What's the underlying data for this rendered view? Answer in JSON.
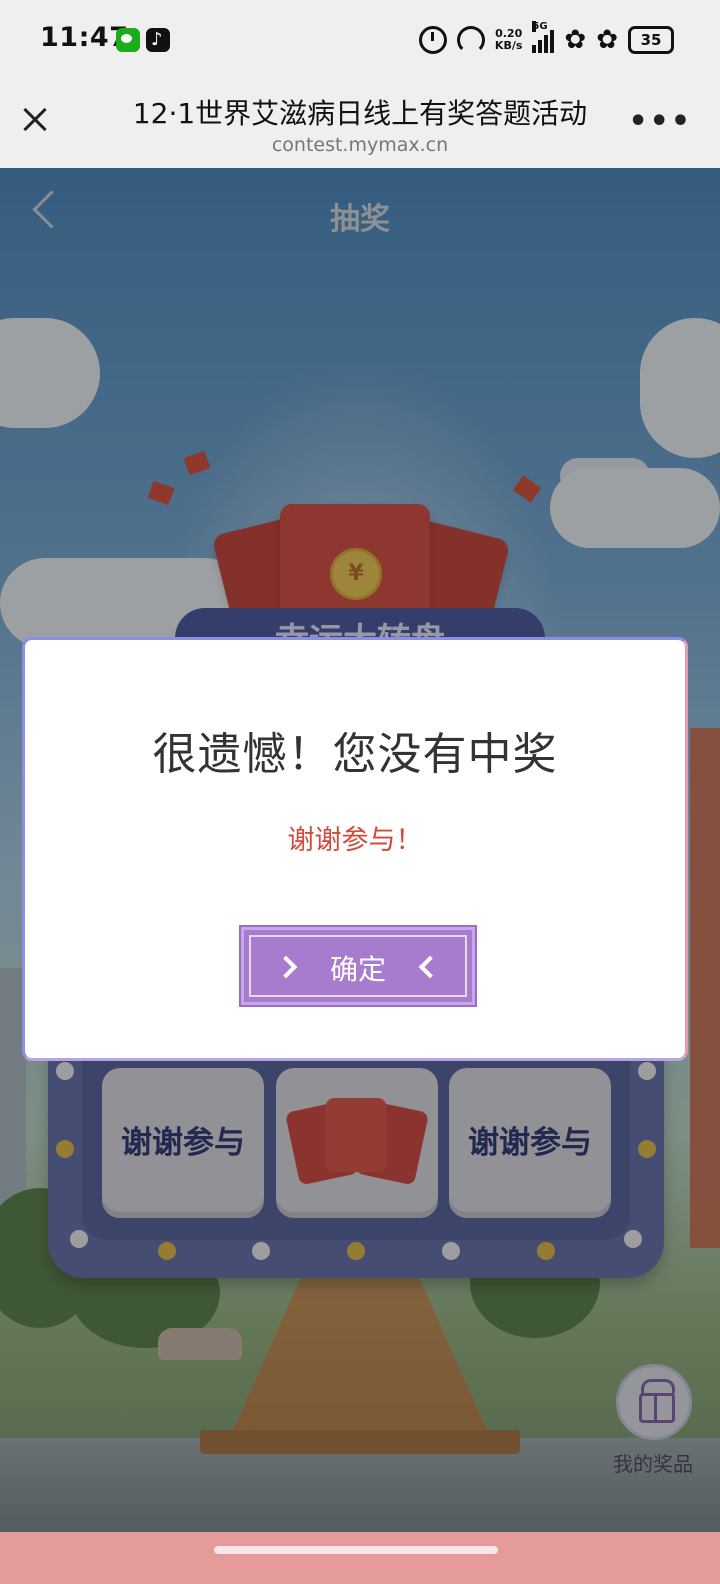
{
  "status_bar": {
    "time": "11:47",
    "net_speed_value": "0.20",
    "net_speed_unit": "KB/s",
    "network_type": "5G",
    "battery": "35"
  },
  "browser": {
    "title": "12·1世界艾滋病日线上有奖答题活动",
    "url": "contest.mymax.cn",
    "more_label": "•••"
  },
  "page": {
    "nav_title": "抽奖",
    "banner_peek": "幸运大转盘",
    "coin_symbol": "¥"
  },
  "grid": {
    "cells": [
      "谢谢参与",
      "",
      "谢谢参与"
    ]
  },
  "prizes": {
    "label": "我的奖品"
  },
  "modal": {
    "title": "很遗憾！您没有中奖",
    "subtitle": "谢谢参与！",
    "confirm_label": "确定"
  },
  "colors": {
    "modal_subtitle": "#d24a3c",
    "confirm_button": "#a77ccf",
    "bottom_bar": "#e59b9a"
  }
}
